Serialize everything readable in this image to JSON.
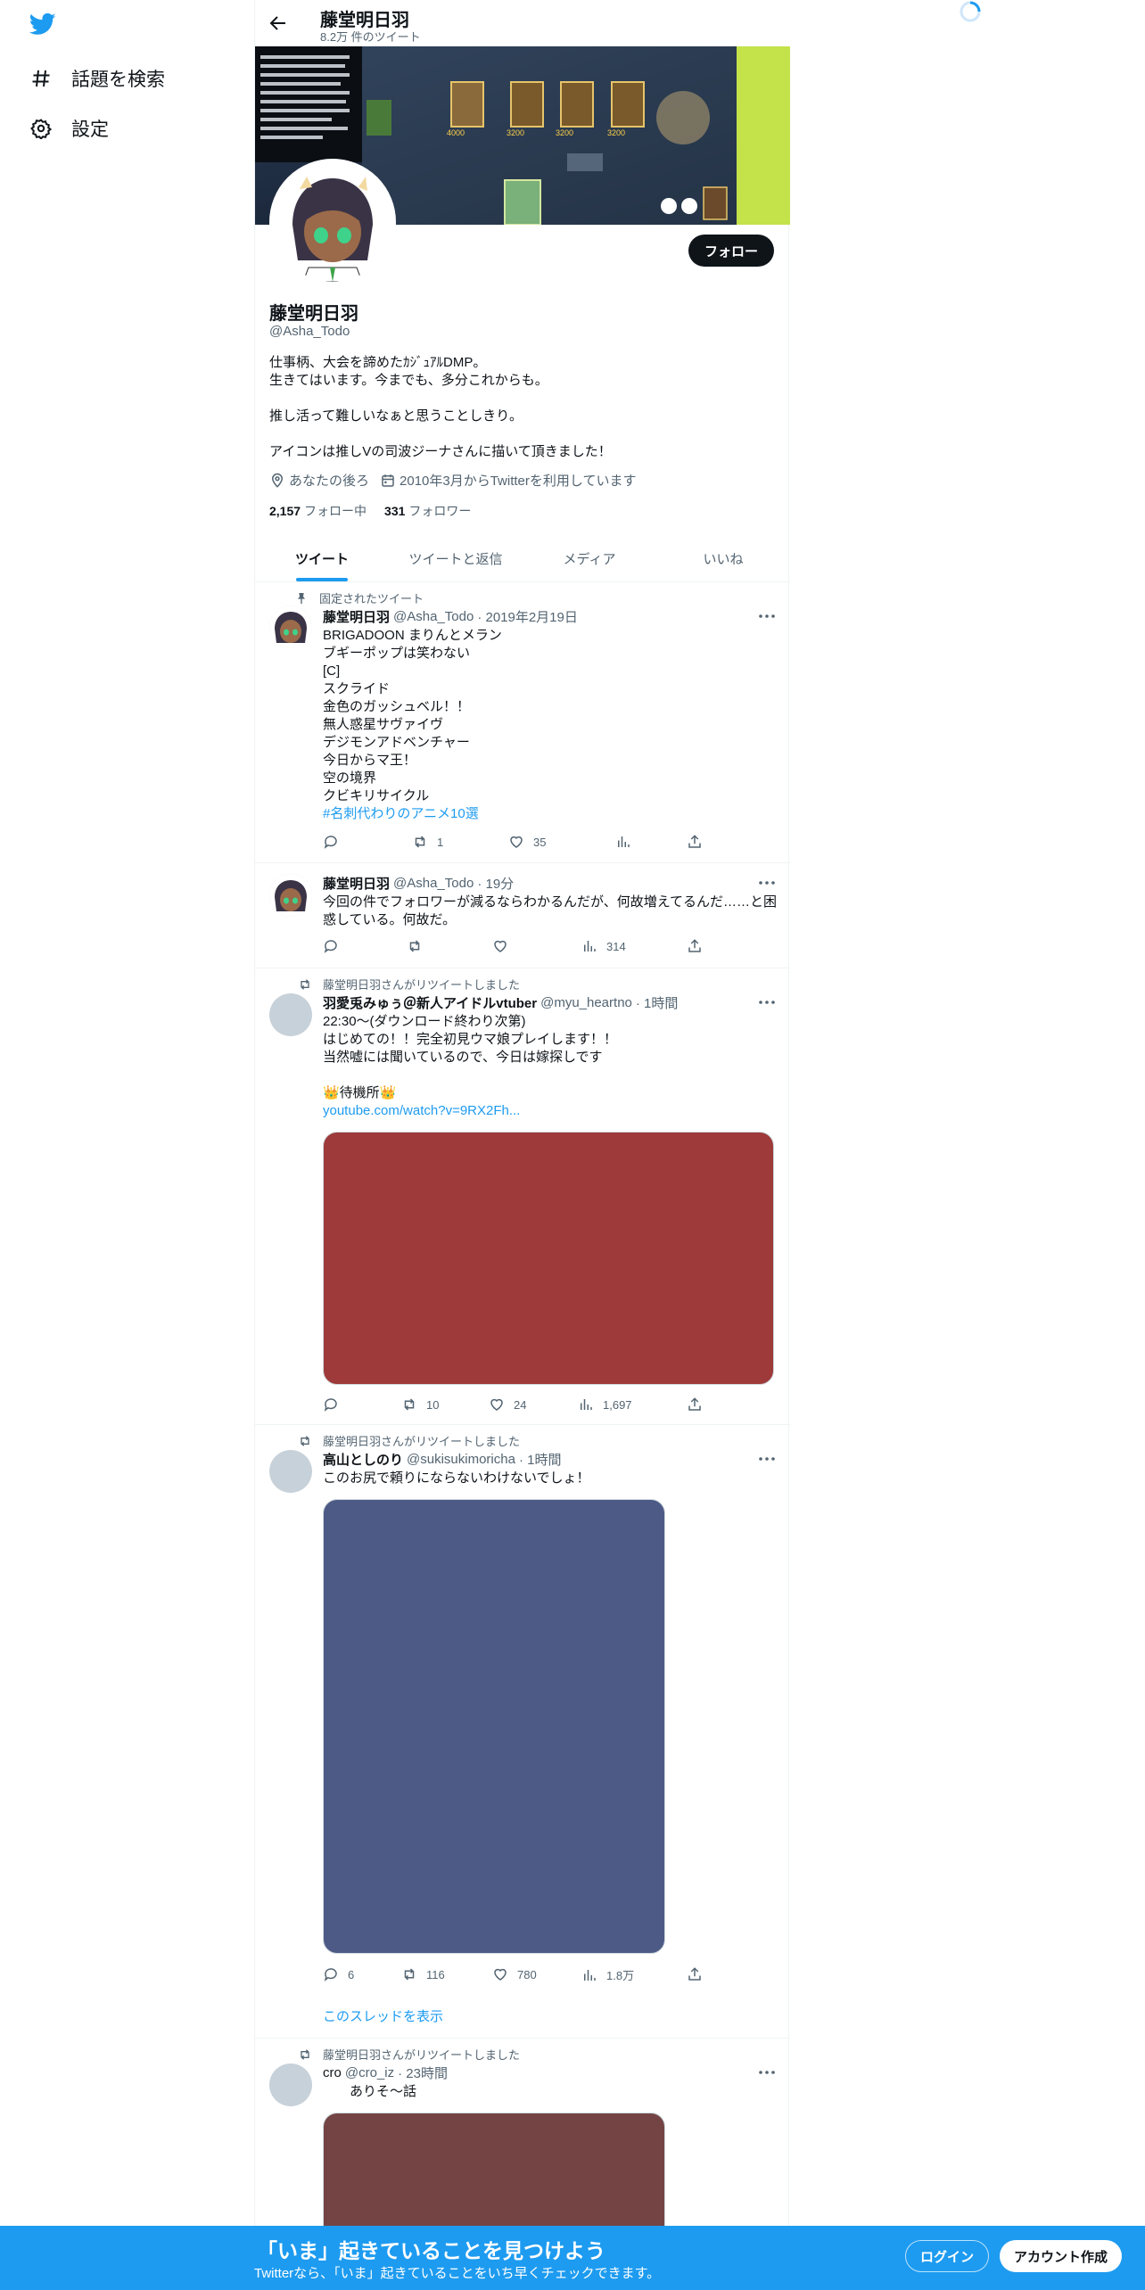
{
  "sidebar": {
    "logo": "twitter-bird-icon",
    "items": [
      {
        "label": "話題を検索",
        "icon": "hashtag-icon"
      },
      {
        "label": "設定",
        "icon": "gear-icon"
      }
    ]
  },
  "header": {
    "name": "藤堂明日羽",
    "tweet_count": "8.2万 件のツイート"
  },
  "profile": {
    "name": "藤堂明日羽",
    "handle": "@Asha_Todo",
    "follow_label": "フォロー",
    "bio": [
      "仕事柄、大会を諦めたｶｼﾞｭｱﾙDMP。",
      "生きてはいます。今までも、多分これからも。",
      "",
      "推し活って難しいなぁと思うことしきり。",
      "",
      "アイコンは推しVの司波ジーナさんに描いて頂きました！"
    ],
    "location": "あなたの後ろ",
    "joined": "2010年3月からTwitterを利用しています",
    "following_count": "2,157",
    "following_label": "フォロー中",
    "followers_count": "331",
    "followers_label": "フォロワー"
  },
  "tabs": [
    {
      "label": "ツイート",
      "active": true
    },
    {
      "label": "ツイートと返信",
      "active": false
    },
    {
      "label": "メディア",
      "active": false
    },
    {
      "label": "いいね",
      "active": false
    }
  ],
  "tweets": [
    {
      "social": "固定されたツイート",
      "name": "藤堂明日羽",
      "handle": "@Asha_Todo",
      "date": "· 2019年2月19日",
      "lines": [
        "BRIGADOON まりんとメラン",
        "ブギーポップは笑わない",
        "[C]",
        "スクライド",
        "金色のガッシュベル！！",
        "無人惑星サヴァイヴ",
        "デジモンアドベンチャー",
        "今日からマ王！",
        "空の境界",
        "クビキリサイクル"
      ],
      "hashtag": "#名刺代わりのアニメ10選",
      "reply": "",
      "retweet": "1",
      "like": "35",
      "views": ""
    },
    {
      "name": "藤堂明日羽",
      "handle": "@Asha_Todo",
      "date": "· 19分",
      "lines": [
        "今回の件でフォロワーが減るならわかるんだが、何故増えてるんだ……と困",
        "惑している。何故だ。"
      ],
      "reply": "",
      "retweet": "",
      "like": "",
      "views": "314"
    },
    {
      "social": "藤堂明日羽さんがリツイートしました",
      "name": "羽愛兎みゅぅ＠新人アイドルvtuber",
      "handle": "@myu_heartno",
      "date": "· 1時間",
      "lines": [
        "22:30～(ダウンロード終わり次第)",
        "はじめての！！完全初見ウマ娘プレイします！！",
        "当然嘘には聞いているので、今日は嫁探しです",
        "",
        "👑待機所👑"
      ],
      "link": "youtube.com/watch?v=9RX2Fh...",
      "media_color": "#9e3a3a",
      "reply": "",
      "retweet": "10",
      "like": "24",
      "views": "1,697"
    },
    {
      "social": "藤堂明日羽さんがリツイートしました",
      "name": "高山としのり",
      "handle": "@sukisukimoricha",
      "date": "· 1時間",
      "lines": [
        "このお尻で頼りにならないわけないでしょ！"
      ],
      "media_color": "#4e5a86",
      "reply": "6",
      "retweet": "116",
      "like": "780",
      "views": "1.8万",
      "show_thread": "このスレッドを表示"
    },
    {
      "social": "藤堂明日羽さんがリツイートしました",
      "name": "cro",
      "handle": "@cro_iz",
      "date": "· 23時間",
      "lines": [
        "　　ありそ～話"
      ],
      "media_color": "#744444"
    }
  ],
  "bottom_bar": {
    "title": "「いま」起きていることを見つけよう",
    "subtitle": "Twitterなら、「いま」起きていることをいち早くチェックできます。",
    "login": "ログイン",
    "signup": "アカウント作成"
  },
  "colors": {
    "accent": "#1d9bf0",
    "text": "#0f1419",
    "muted": "#536471"
  }
}
